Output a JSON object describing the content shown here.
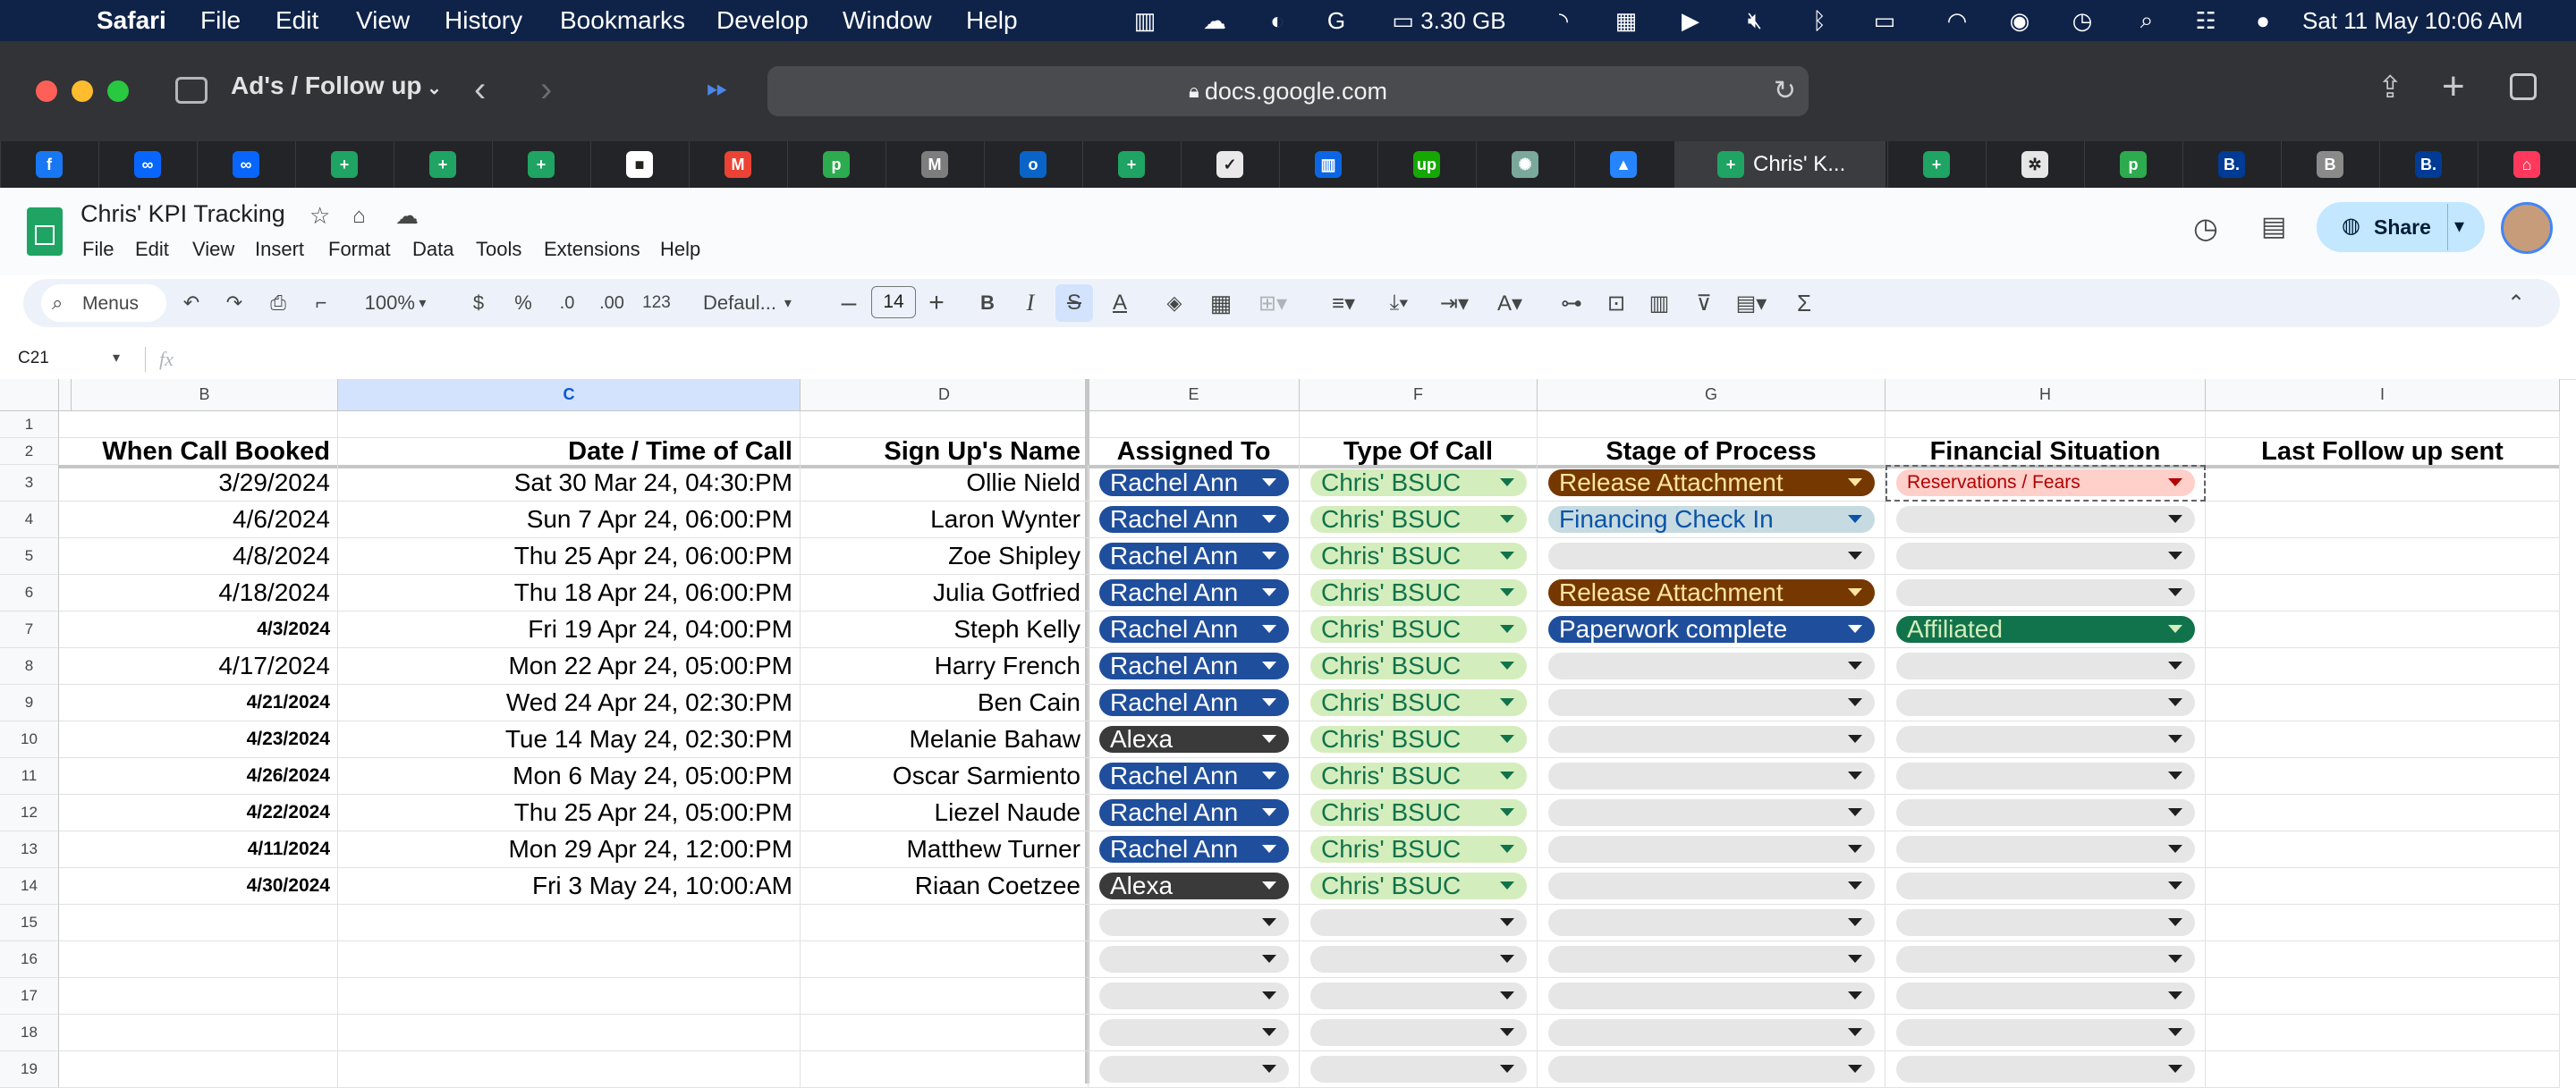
{
  "menubar": {
    "app": "Safari",
    "items": [
      "File",
      "Edit",
      "View",
      "History",
      "Bookmarks",
      "Develop",
      "Window",
      "Help"
    ],
    "memory": "3.30 GB",
    "datetime": "Sat 11 May  10:06 AM"
  },
  "safari": {
    "tab_group": "Ad's / Follow up",
    "url": "docs.google.com",
    "active_tab_title": "Chris' K...",
    "pinned_tabs": [
      {
        "icon": "facebook-icon",
        "color": "#1877f2",
        "glyph": "f"
      },
      {
        "icon": "meta-icon",
        "color": "#0866ff",
        "glyph": "∞"
      },
      {
        "icon": "meta-icon",
        "color": "#0866ff",
        "glyph": "∞"
      },
      {
        "icon": "google-sheets-icon",
        "color": "#1fa463",
        "glyph": "+"
      },
      {
        "icon": "google-sheets-icon",
        "color": "#1fa463",
        "glyph": "+"
      },
      {
        "icon": "google-sheets-icon",
        "color": "#1fa463",
        "glyph": "+"
      },
      {
        "icon": "app-icon",
        "color": "#ffffff",
        "glyph": "■"
      },
      {
        "icon": "gmail-icon",
        "color": "#ea4335",
        "glyph": "M"
      },
      {
        "icon": "pipedrive-icon",
        "color": "#2dab4f",
        "glyph": "p"
      },
      {
        "icon": "m-icon",
        "color": "#7d7d7d",
        "glyph": "M"
      },
      {
        "icon": "outlook-icon",
        "color": "#0a64c8",
        "glyph": "o"
      },
      {
        "icon": "google-sheets-icon",
        "color": "#1fa463",
        "glyph": "+"
      },
      {
        "icon": "checklist-icon",
        "color": "#e9e9e9",
        "glyph": "✓"
      },
      {
        "icon": "trello-icon",
        "color": "#0c66e4",
        "glyph": "▥"
      },
      {
        "icon": "upwork-icon",
        "color": "#14a800",
        "glyph": "up"
      },
      {
        "icon": "chatgpt-icon",
        "color": "#7aa89a",
        "glyph": "✺"
      },
      {
        "icon": "google-drive-icon",
        "color": "#2684fc",
        "glyph": "▲"
      }
    ],
    "tabs_after": [
      {
        "icon": "google-sheets-icon",
        "color": "#1fa463",
        "glyph": "+"
      },
      {
        "icon": "brand-icon",
        "color": "#e6e6e6",
        "glyph": "✲"
      },
      {
        "icon": "pipedrive-icon",
        "color": "#2dab4f",
        "glyph": "p"
      },
      {
        "icon": "booking-icon",
        "color": "#003b95",
        "glyph": "B."
      },
      {
        "icon": "b-icon",
        "color": "#8a8a8a",
        "glyph": "B"
      },
      {
        "icon": "booking-icon",
        "color": "#003b95",
        "glyph": "B."
      },
      {
        "icon": "airbnb-icon",
        "color": "#ff385c",
        "glyph": "⌂"
      }
    ]
  },
  "doc": {
    "title": "Chris' KPI Tracking",
    "menus": [
      "File",
      "Edit",
      "View",
      "Insert",
      "Format",
      "Data",
      "Tools",
      "Extensions",
      "Help"
    ],
    "share_label": "Share"
  },
  "toolbar": {
    "search": "Menus",
    "zoom": "100%",
    "currency": "$",
    "percent": "%",
    "dec_minus": ".0",
    "dec_plus": ".00",
    "format_123": "123",
    "font": "Defaul...",
    "font_size": "14"
  },
  "formula": {
    "cell_ref": "C21",
    "fx": "fx"
  },
  "grid": {
    "columns": [
      "B",
      "C",
      "D",
      "E",
      "F",
      "G",
      "H",
      "I"
    ],
    "headers": [
      "When Call Booked",
      "Date / Time of Call",
      "Sign Up's Name",
      "Assigned To",
      "Type Of Call",
      "Stage of Process",
      "Financial Situation",
      "Last Follow up sent"
    ],
    "row_numbers": [
      "1",
      "2",
      "3",
      "4",
      "5",
      "6",
      "7",
      "8",
      "9",
      "10",
      "11",
      "12",
      "13",
      "14",
      "15",
      "16",
      "17",
      "18",
      "19"
    ],
    "rows": [
      {
        "booked": "3/29/2024",
        "call": "Sat 30 Mar 24, 04:30:PM",
        "name": "Ollie Nield",
        "assigned": "Rachel Ann",
        "type": "Chris' BSUC",
        "stage": "Release Attachment",
        "finance": "Reservations / Fears"
      },
      {
        "booked": "4/6/2024",
        "call": "Sun 7 Apr 24, 06:00:PM",
        "name": "Laron Wynter",
        "assigned": "Rachel Ann",
        "type": "Chris' BSUC",
        "stage": "Financing Check In",
        "finance": ""
      },
      {
        "booked": "4/8/2024",
        "call": "Thu 25 Apr 24, 06:00:PM",
        "name": "Zoe Shipley",
        "assigned": "Rachel Ann",
        "type": "Chris' BSUC",
        "stage": "",
        "finance": ""
      },
      {
        "booked": "4/18/2024",
        "call": "Thu 18 Apr 24, 06:00:PM",
        "name": "Julia Gotfried",
        "assigned": "Rachel Ann",
        "type": "Chris' BSUC",
        "stage": "Release Attachment",
        "finance": ""
      },
      {
        "booked": "4/3/2024",
        "call": "Fri 19 Apr 24, 04:00:PM",
        "name": "Steph Kelly",
        "assigned": "Rachel Ann",
        "type": "Chris' BSUC",
        "stage": "Paperwork complete",
        "finance": "Affiliated"
      },
      {
        "booked": "4/17/2024",
        "call": "Mon 22 Apr 24, 05:00:PM",
        "name": "Harry French",
        "assigned": "Rachel Ann",
        "type": "Chris' BSUC",
        "stage": "",
        "finance": ""
      },
      {
        "booked": "4/21/2024",
        "call": "Wed 24 Apr 24, 02:30:PM",
        "name": "Ben Cain",
        "assigned": "Rachel Ann",
        "type": "Chris' BSUC",
        "stage": "",
        "finance": ""
      },
      {
        "booked": "4/23/2024",
        "call": "Tue 14 May 24, 02:30:PM",
        "name": "Melanie Bahaw",
        "assigned": "Alexa",
        "type": "Chris' BSUC",
        "stage": "",
        "finance": ""
      },
      {
        "booked": "4/26/2024",
        "call": "Mon 6 May 24, 05:00:PM",
        "name": "Oscar Sarmiento",
        "assigned": "Rachel Ann",
        "type": "Chris' BSUC",
        "stage": "",
        "finance": ""
      },
      {
        "booked": "4/22/2024",
        "call": "Thu 25 Apr 24, 05:00:PM",
        "name": "Liezel Naude",
        "assigned": "Rachel Ann",
        "type": "Chris' BSUC",
        "stage": "",
        "finance": ""
      },
      {
        "booked": "4/11/2024",
        "call": "Mon 29 Apr 24, 12:00:PM",
        "name": "Matthew Turner",
        "assigned": "Rachel Ann",
        "type": "Chris' BSUC",
        "stage": "",
        "finance": ""
      },
      {
        "booked": "4/30/2024",
        "call": "Fri 3 May 24, 10:00:AM",
        "name": "Riaan Coetzee",
        "assigned": "Alexa",
        "type": "Chris' BSUC",
        "stage": "",
        "finance": ""
      }
    ],
    "small_booked_rows": [
      4,
      6,
      7,
      8,
      9,
      10,
      11
    ],
    "chip_colors": {
      "Rachel Ann": {
        "bg": "#1f4e9c",
        "fg": "#ffffff"
      },
      "Alexa": {
        "bg": "#3a3a3a",
        "fg": "#ffffff"
      },
      "Chris' BSUC": {
        "bg": "#d4edbc",
        "fg": "#11734b"
      },
      "Release Attachment": {
        "bg": "#753800",
        "fg": "#ffe5a0"
      },
      "Financing Check In": {
        "bg": "#c6dbe1",
        "fg": "#0a53a8"
      },
      "Paperwork complete": {
        "bg": "#1f4e9c",
        "fg": "#ffffff"
      },
      "Reservations / Fears": {
        "bg": "#ffcfc9",
        "fg": "#b10202"
      },
      "Affiliated": {
        "bg": "#11734b",
        "fg": "#d4edbc"
      },
      "": {
        "bg": "#e6e6e6",
        "fg": "#000000"
      }
    }
  }
}
